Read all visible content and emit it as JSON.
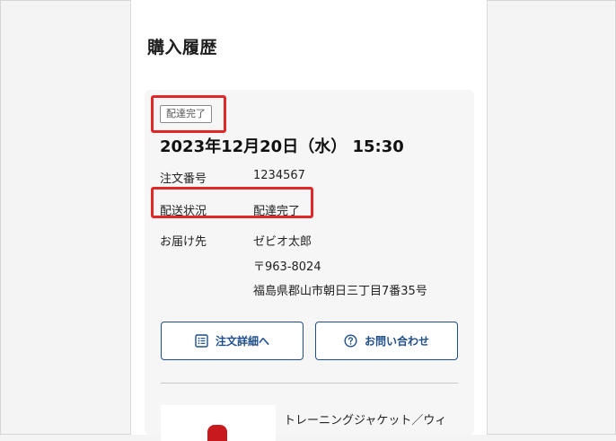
{
  "page": {
    "title": "購入履歴"
  },
  "order": {
    "status_badge": "配達完了",
    "datetime": "2023年12月20日（水） 15:30",
    "order_number_label": "注文番号",
    "order_number": "1234567",
    "shipping_status_label": "配送状況",
    "shipping_status": "配達完了",
    "recipient_label": "お届け先",
    "recipient_name": "ゼビオ太郎",
    "postal_code": "〒963-8024",
    "address": "福島県郡山市朝日三丁目7番35号"
  },
  "buttons": {
    "detail_label": "注文詳細へ",
    "detail_icon": "list-icon",
    "inquiry_label": "お問い合わせ",
    "inquiry_icon": "question-circle-icon"
  },
  "product": {
    "name": "トレーニングジャケット／ウィ"
  },
  "colors": {
    "accent": "#1f4e8c",
    "highlight": "#e02828",
    "card_bg": "#f6f6f6"
  }
}
